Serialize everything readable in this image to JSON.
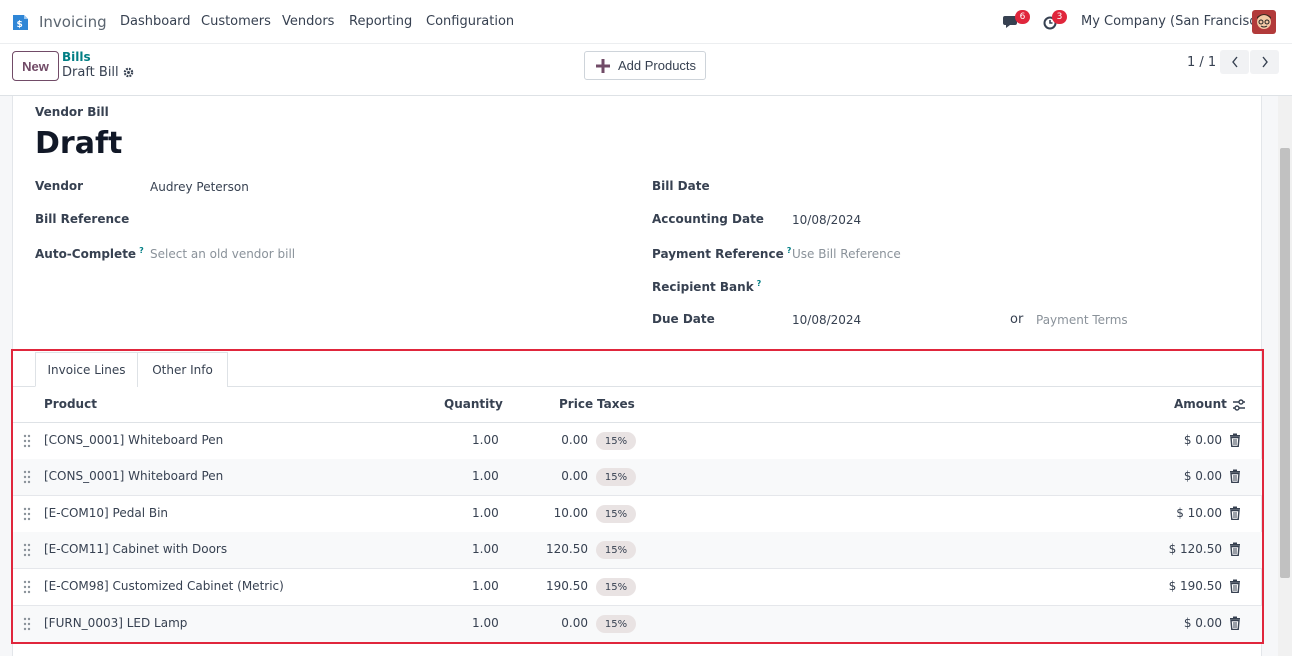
{
  "app": {
    "name": "Invoicing"
  },
  "menu": [
    "Dashboard",
    "Customers",
    "Vendors",
    "Reporting",
    "Configuration"
  ],
  "systray": {
    "messages_count": "6",
    "activities_count": "3",
    "company": "My Company (San Francisco)"
  },
  "control_panel": {
    "new_label": "New",
    "breadcrumb_parent": "Bills",
    "breadcrumb_current": "Draft Bill",
    "add_products_label": "Add Products",
    "pager": "1 / 1"
  },
  "form": {
    "kind": "Vendor Bill",
    "status": "Draft",
    "left_fields": [
      {
        "label": "Vendor",
        "value": "Audrey Peterson",
        "placeholder": ""
      },
      {
        "label": "Bill Reference",
        "value": "",
        "placeholder": ""
      },
      {
        "label": "Auto-Complete",
        "value": "",
        "placeholder": "Select an old vendor bill",
        "help": "?"
      }
    ],
    "right_fields": [
      {
        "label": "Bill Date",
        "value": "",
        "placeholder": ""
      },
      {
        "label": "Accounting Date",
        "value": "10/08/2024",
        "placeholder": ""
      },
      {
        "label": "Payment Reference",
        "value": "",
        "placeholder": "Use Bill Reference",
        "help": "?"
      },
      {
        "label": "Recipient Bank",
        "value": "",
        "placeholder": "",
        "help": "?"
      },
      {
        "label": "Due Date",
        "value": "10/08/2024",
        "placeholder": ""
      }
    ],
    "due_date_or": "or",
    "payment_terms_placeholder": "Payment Terms"
  },
  "tabs": [
    "Invoice Lines",
    "Other Info"
  ],
  "lines": {
    "headers": {
      "product": "Product",
      "quantity": "Quantity",
      "price": "Price",
      "taxes": "Taxes",
      "amount": "Amount"
    },
    "rows": [
      {
        "product": "[CONS_0001] Whiteboard Pen",
        "quantity": "1.00",
        "price": "0.00",
        "tax": "15%",
        "amount": "$ 0.00"
      },
      {
        "product": "[CONS_0001] Whiteboard Pen",
        "quantity": "1.00",
        "price": "0.00",
        "tax": "15%",
        "amount": "$ 0.00"
      },
      {
        "product": "[E-COM10] Pedal Bin",
        "quantity": "1.00",
        "price": "10.00",
        "tax": "15%",
        "amount": "$ 10.00"
      },
      {
        "product": "[E-COM11] Cabinet with Doors",
        "quantity": "1.00",
        "price": "120.50",
        "tax": "15%",
        "amount": "$ 120.50"
      },
      {
        "product": "[E-COM98] Customized Cabinet (Metric)",
        "quantity": "1.00",
        "price": "190.50",
        "tax": "15%",
        "amount": "$ 190.50"
      },
      {
        "product": "[FURN_0003] LED Lamp",
        "quantity": "1.00",
        "price": "0.00",
        "tax": "15%",
        "amount": "$ 0.00"
      }
    ]
  },
  "colors": {
    "brand": "#714b67",
    "link": "#017e84",
    "badge": "#e0263c",
    "highlight": "#e0263c"
  }
}
